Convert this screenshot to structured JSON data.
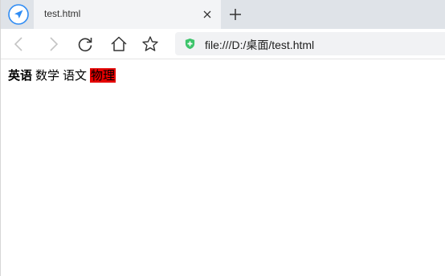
{
  "tab": {
    "title": "test.html"
  },
  "address": {
    "url": "file:///D:/桌面/test.html"
  },
  "page": {
    "words": [
      "英语",
      "数学",
      "语文",
      "物理"
    ]
  },
  "colors": {
    "highlight": "#e40000",
    "shield": "#3cc46a",
    "logo": "#2f8cf4"
  },
  "icons": {
    "logo": "browser-logo-icon",
    "close": "close-icon",
    "new_tab": "plus-icon",
    "back": "back-arrow-icon",
    "forward": "forward-arrow-icon",
    "reload": "reload-icon",
    "home": "home-icon",
    "bookmark": "star-icon",
    "security": "shield-icon"
  }
}
